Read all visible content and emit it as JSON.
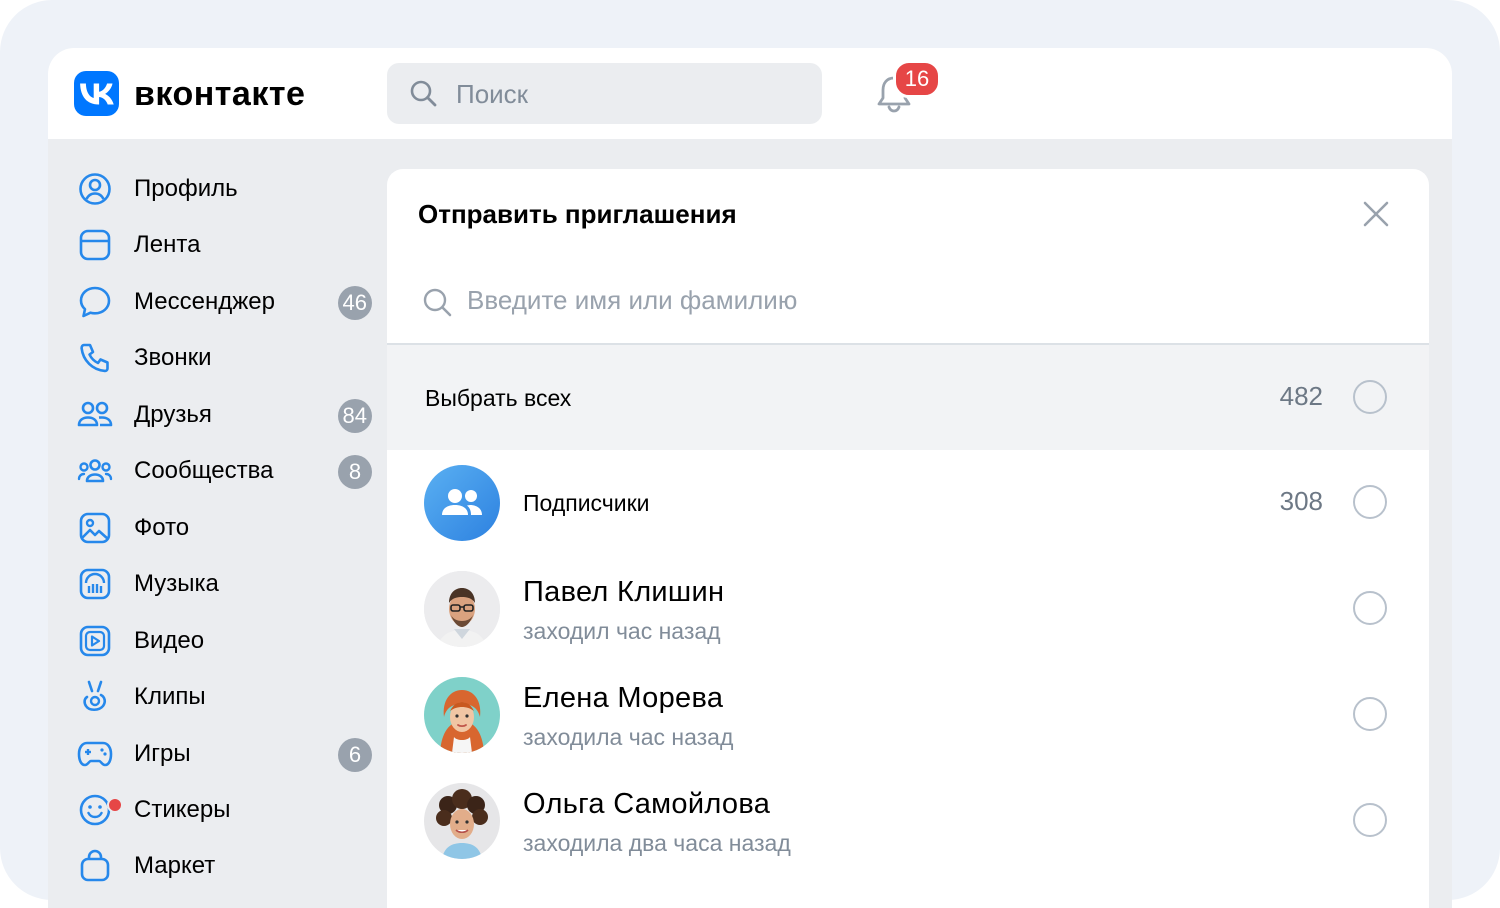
{
  "brand": {
    "name": "вконтакте",
    "accent": "#0077ff"
  },
  "header": {
    "search_placeholder": "Поиск",
    "notifications_count": "16"
  },
  "sidebar": {
    "items": [
      {
        "label": "Профиль",
        "icon": "profile-icon"
      },
      {
        "label": "Лента",
        "icon": "feed-icon"
      },
      {
        "label": "Мессенджер",
        "icon": "messenger-icon",
        "count": "46"
      },
      {
        "label": "Звонки",
        "icon": "phone-icon"
      },
      {
        "label": "Друзья",
        "icon": "friends-icon",
        "count": "84"
      },
      {
        "label": "Сообщества",
        "icon": "communities-icon",
        "count": "8"
      },
      {
        "label": "Фото",
        "icon": "photo-icon"
      },
      {
        "label": "Музыка",
        "icon": "music-icon"
      },
      {
        "label": "Видео",
        "icon": "video-icon"
      },
      {
        "label": "Клипы",
        "icon": "clips-icon"
      },
      {
        "label": "Игры",
        "icon": "games-icon",
        "count": "6"
      },
      {
        "label": "Стикеры",
        "icon": "stickers-icon"
      },
      {
        "label": "Маркет",
        "icon": "market-icon"
      }
    ]
  },
  "modal": {
    "title": "Отправить приглашения",
    "search_placeholder": "Введите имя или фамилию",
    "select_all": {
      "label": "Выбрать всех",
      "count": "482"
    },
    "subscribers": {
      "label": "Подписчики",
      "count": "308"
    },
    "people": [
      {
        "name": "Павел Клишин",
        "status": "заходил час назад"
      },
      {
        "name": "Елена Морева",
        "status": "заходила час назад"
      },
      {
        "name": "Ольга Самойлова",
        "status": "заходила два часа назад"
      }
    ]
  },
  "colors": {
    "badge_red": "#e64646",
    "count_gray": "#99a2ad",
    "icon_blue": "#2688eb"
  }
}
